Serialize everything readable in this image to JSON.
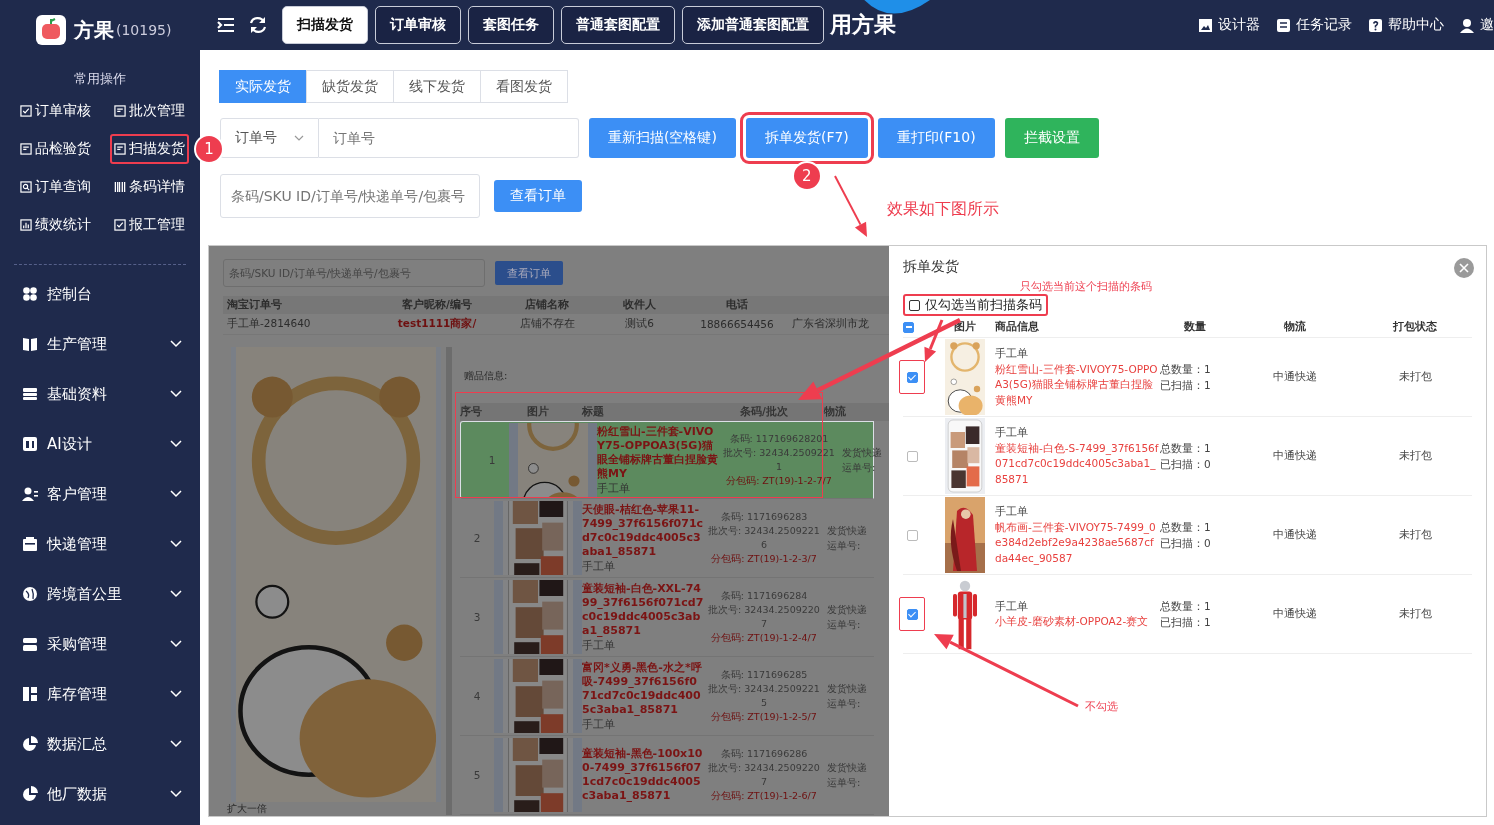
{
  "sidebar": {
    "logo": "方果",
    "account": "(10195)",
    "section_title": "常用操作",
    "quick_links": [
      {
        "label": "订单审核"
      },
      {
        "label": "批次管理"
      },
      {
        "label": "品检验货"
      },
      {
        "label": "扫描发货",
        "step": "1"
      },
      {
        "label": "订单查询"
      },
      {
        "label": "条码详情"
      },
      {
        "label": "绩效统计"
      },
      {
        "label": "报工管理"
      }
    ],
    "menu": [
      {
        "label": "控制台",
        "expandable": false
      },
      {
        "label": "生产管理",
        "expandable": true
      },
      {
        "label": "基础资料",
        "expandable": true
      },
      {
        "label": "AI设计",
        "expandable": true
      },
      {
        "label": "客户管理",
        "expandable": true
      },
      {
        "label": "快递管理",
        "expandable": true
      },
      {
        "label": "跨境首公里",
        "expandable": true
      },
      {
        "label": "采购管理",
        "expandable": true
      },
      {
        "label": "库存管理",
        "expandable": true
      },
      {
        "label": "数据汇总",
        "expandable": true
      },
      {
        "label": "他厂数据",
        "expandable": true
      }
    ]
  },
  "topbar": {
    "tabs": [
      {
        "label": "扫描发货",
        "selected": true
      },
      {
        "label": "订单审核",
        "selected": false
      },
      {
        "label": "套图任务",
        "selected": false
      },
      {
        "label": "普通套图配置",
        "selected": false
      },
      {
        "label": "添加普通套图配置",
        "selected": false
      }
    ],
    "banner_text": "用方果",
    "links": [
      "设计器",
      "任务记录",
      "帮助中心",
      "邀"
    ]
  },
  "subtabs": [
    {
      "label": "实际发货",
      "selected": true
    },
    {
      "label": "缺货发货",
      "selected": false
    },
    {
      "label": "线下发货",
      "selected": false
    },
    {
      "label": "看图发货",
      "selected": false
    }
  ],
  "scan": {
    "field_type": "订单号",
    "placeholder": "订单号",
    "buttons": [
      {
        "label": "重新扫描(空格键)",
        "kind": "primary"
      },
      {
        "label": "拆单发货(F7)",
        "kind": "primary",
        "step": "2"
      },
      {
        "label": "重打印(F10)",
        "kind": "primary"
      },
      {
        "label": "拦截设置",
        "kind": "success"
      }
    ],
    "search_placeholder": "条码/SKU ID/订单号/快递单号/包裹号",
    "search_button": "查看订单"
  },
  "annotations": {
    "effect_note": "效果如下图所示",
    "only_current_note": "只勾选当前这个扫描的条码",
    "uncheck_note": "不勾选"
  },
  "preview": {
    "search_placeholder": "条码/SKU ID/订单号/快递单号/包裹号",
    "search_button": "查看订单",
    "order_columns": [
      "淘宝订单号",
      "客户昵称/编号",
      "店铺名称",
      "收件人",
      "电话"
    ],
    "order_row": [
      "手工单-2814640",
      "test1111商家/",
      "店铺不存在",
      "测试6",
      "18866654456",
      "广东省深圳市龙"
    ],
    "gift_label": "赠品信息:",
    "item_columns": [
      "序号",
      "图片",
      "标题",
      "条码/批次",
      "物流"
    ],
    "items": [
      {
        "index": "1",
        "title": "粉红雪山-三件套-VIVOY75-OPPOA3(5G)猫眼全铺标牌古董白捏脸黄熊MY",
        "source": "手工单",
        "barcode": "条码: 117169628201",
        "batch": "批次号: 32434.25092211",
        "package": "分包码: ZT(19)-1-2-7/7",
        "logistics": "发货快递",
        "waybill": "运单号:",
        "selected": true,
        "highlighted": true
      },
      {
        "index": "2",
        "title": "天使眼-桔红色-苹果11-7499_37f6156f071cd7c0c19ddc4005c3aba1_85871",
        "source": "手工单",
        "barcode": "条码: 1171696283",
        "batch": "批次号: 32434.25092216",
        "package": "分包码: ZT(19)-1-2-3/7",
        "logistics": "发货快递",
        "waybill": "运单号:",
        "selected": false,
        "highlighted": false
      },
      {
        "index": "3",
        "title": "童装短袖-白色-XXL-7499_37f6156f071cd7c0c19ddc4005c3aba1_85871",
        "source": "手工单",
        "barcode": "条码: 1171696284",
        "batch": "批次号: 32434.25092207",
        "package": "分包码: ZT(19)-1-2-4/7",
        "logistics": "发货快递",
        "waybill": "运单号:",
        "selected": false,
        "highlighted": false
      },
      {
        "index": "4",
        "title": "富冈*义勇-黑色-水之*呼吸-7499_37f6156f071cd7c0c19ddc4005c3aba1_85871",
        "source": "手工单",
        "barcode": "条码: 1171696285",
        "batch": "批次号: 32434.25092215",
        "package": "分包码: ZT(19)-1-2-5/7",
        "logistics": "发货快递",
        "waybill": "运单号:",
        "selected": false,
        "highlighted": false
      },
      {
        "index": "5",
        "title": "童装短袖-黑色-100x100-7499_37f6156f071cd7c0c19ddc4005c3aba1_85871",
        "barcode": "条码: 1171696286",
        "batch": "批次号: 32434.25092207",
        "package": "分包码: ZT(19)-1-2-6/7",
        "logistics": "发货快递",
        "waybill": "运单号:",
        "selected": false,
        "highlighted": false
      }
    ],
    "zoom_label": "扩大一倍"
  },
  "split_dialog": {
    "title": "拆单发货",
    "only_current": {
      "label": "仅勾选当前扫描条码",
      "checked": false,
      "highlighted": true
    },
    "select_all": {
      "indeterminate": true
    },
    "columns": [
      "图片",
      "商品信息",
      "数量",
      "物流",
      "打包状态"
    ],
    "rows": [
      {
        "checked": true,
        "highlighted": true,
        "source": "手工单",
        "title": "粉红雪山-三件套-VIVOY75-OPPOA3(5G)猫眼全铺标牌古董白捏脸黄熊MY",
        "total": "总数量：1",
        "scanned": "已扫描：1",
        "logistics": "中通快递",
        "status": "未打包"
      },
      {
        "checked": false,
        "highlighted": false,
        "source": "手工单",
        "title": "童装短袖-白色-S-7499_37f6156f071cd7c0c19ddc4005c3aba1_85871",
        "total": "总数量：1",
        "scanned": "已扫描：0",
        "logistics": "中通快递",
        "status": "未打包"
      },
      {
        "checked": false,
        "highlighted": false,
        "source": "手工单",
        "title": "帆布画-三件套-VIVOY75-7499_0e384d2ebf2e9a4238ae5687cfda44ec_90587",
        "total": "总数量：1",
        "scanned": "已扫描：0",
        "logistics": "中通快递",
        "status": "未打包"
      },
      {
        "checked": true,
        "highlighted": true,
        "source": "手工单",
        "title": "小羊皮-磨砂素材-OPPOA2-赛文",
        "total": "总数量：1",
        "scanned": "已扫描：1",
        "logistics": "中通快递",
        "status": "未打包"
      }
    ]
  }
}
